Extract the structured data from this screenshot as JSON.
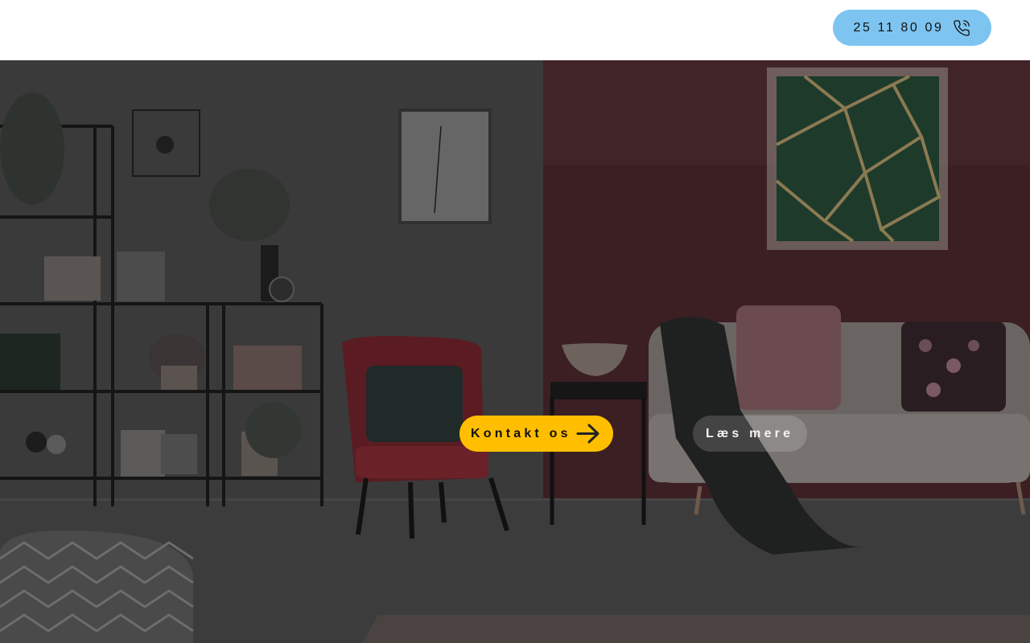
{
  "header": {
    "phone_number": "25 11 80 09",
    "phone_icon": "phone-icon"
  },
  "hero": {
    "primary_cta": {
      "label": "Kontakt os",
      "icon": "arrow-right-icon",
      "color": "#ffbf00"
    },
    "secondary_cta": {
      "label": "Læs mere"
    }
  },
  "colors": {
    "phone_button": "#7ec4f0",
    "accent_yellow": "#ffbf00",
    "header_bg": "#ffffff"
  }
}
